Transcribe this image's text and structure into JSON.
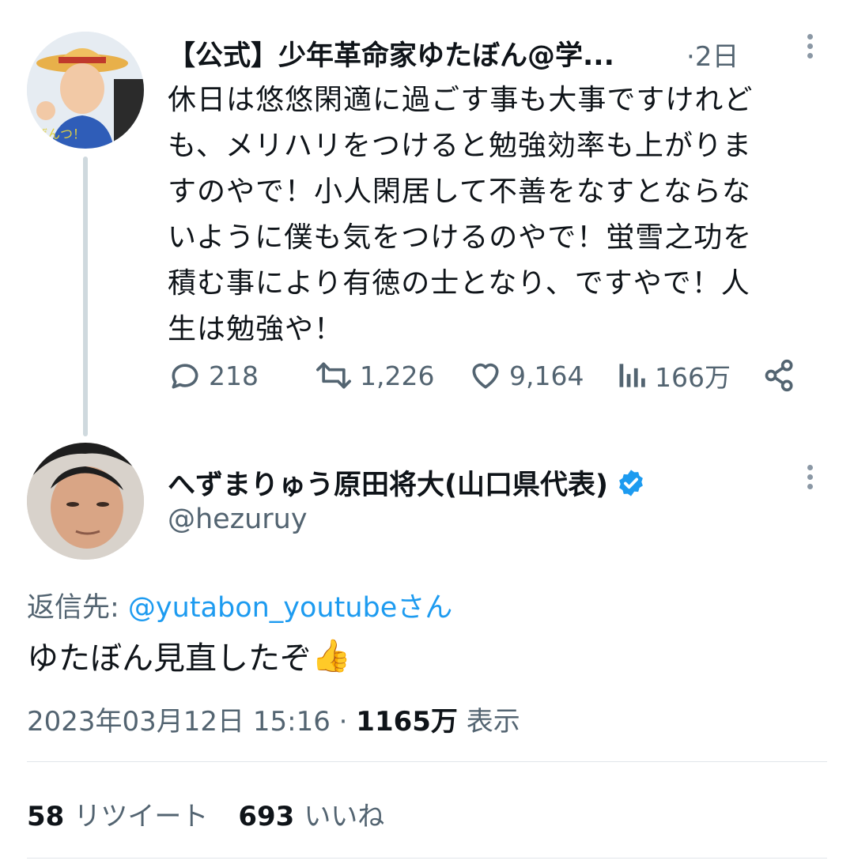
{
  "parent_tweet": {
    "display_name": "【公式】少年革命家ゆたぼん@学...",
    "time_sep": "·",
    "time": "2日",
    "body_lines": [
      "休日は悠悠閑適に過ごす事も大事ですけれど",
      "も、メリハリをつけると勉強効率も上がりま",
      "すのやで！小人閑居して不善をなすとならな",
      "いように僕も気をつけるのやで！蛍雪之功を",
      "積む事により有徳の士となり、ですやで！人",
      "生は勉強や！"
    ],
    "actions": {
      "replies": "218",
      "retweets": "1,226",
      "likes": "9,164",
      "views": "166万"
    }
  },
  "reply_tweet": {
    "display_name": "へずまりゅう原田将大(山口県代表)",
    "handle": "@hezuruy",
    "reply_prefix": "返信先: ",
    "reply_mention": "@yutabon_youtube",
    "reply_suffix": "さん",
    "body": "ゆたぼん見直したぞ",
    "emoji": "👍",
    "date": "2023年03月12日 15:16",
    "meta_sep": " · ",
    "views_count": "1165万",
    "views_label": " 表示",
    "retweet_count": "58",
    "retweet_label": "リツイート",
    "like_count": "693",
    "like_label": "いいね"
  },
  "colors": {
    "accent": "#1d9bf0",
    "secondary_text": "#536471",
    "primary_text": "#0f1419",
    "thread_line": "#cfd9de"
  },
  "icons": [
    "reply-icon",
    "retweet-icon",
    "like-icon",
    "views-icon",
    "share-icon",
    "verified-badge-icon",
    "more-icon"
  ]
}
